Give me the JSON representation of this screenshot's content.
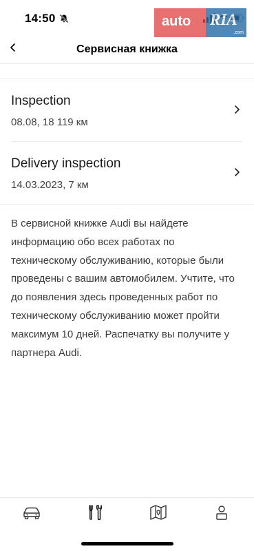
{
  "status_bar": {
    "time": "14:50"
  },
  "watermark": {
    "auto": "auto",
    "ria": "RIA",
    "ria_sub": ".com"
  },
  "header": {
    "title": "Сервисная книжка"
  },
  "entries": [
    {
      "title": "Inspection",
      "subtitle": "08.08, 18 119 км"
    },
    {
      "title": "Delivery inspection",
      "subtitle": "14.03.2023, 7 км"
    }
  ],
  "info_text": "В сервисной книжке Audi вы найдете информацию обо всех работах по техническому обслуживанию, которые были проведены с вашим автомобилем. Учтите, что до появления здесь проведенных работ по техническому обслуживанию может пройти максимум 10 дней. Распечатку вы получите у партнера Audi.",
  "tab_bar": {
    "tabs": [
      {
        "icon": "car-icon"
      },
      {
        "icon": "tools-icon",
        "active": true
      },
      {
        "icon": "map-icon"
      },
      {
        "icon": "profile-icon"
      }
    ]
  }
}
